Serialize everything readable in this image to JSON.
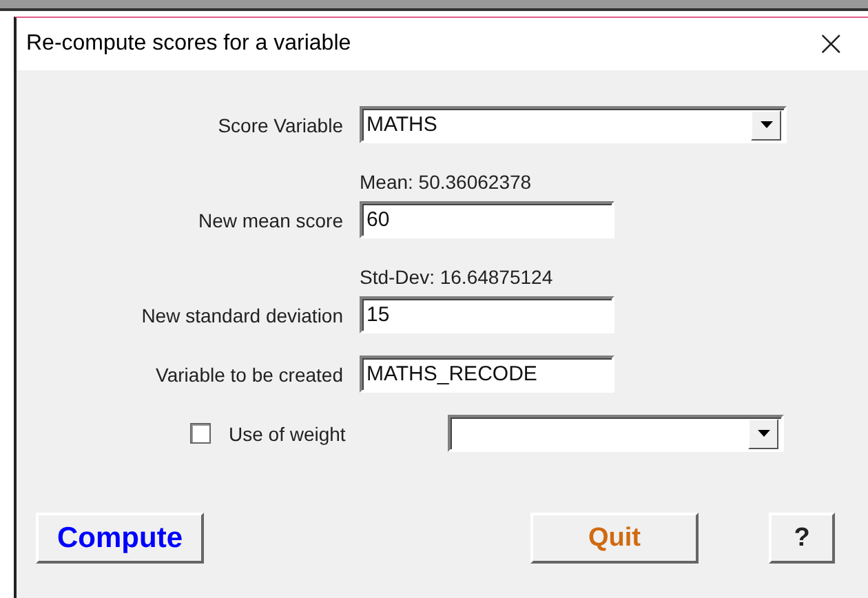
{
  "window": {
    "title": "Re-compute scores for a variable",
    "close": "×"
  },
  "score_variable": {
    "label": "Score Variable",
    "value": "MATHS"
  },
  "mean_info": "Mean: 50.36062378",
  "new_mean": {
    "label": "New mean score",
    "value": "60"
  },
  "std_info": "Std-Dev: 16.64875124",
  "new_std": {
    "label": "New standard deviation",
    "value": "15"
  },
  "new_variable": {
    "label": "Variable to be created",
    "value": "MATHS_RECODE"
  },
  "weight": {
    "label": "Use of weight",
    "checked": false
  },
  "buttons": [
    {
      "label": "Compute",
      "kind": "compute"
    },
    {
      "label": "Quit",
      "kind": "quit"
    },
    {
      "label": "?",
      "kind": "help"
    }
  ]
}
